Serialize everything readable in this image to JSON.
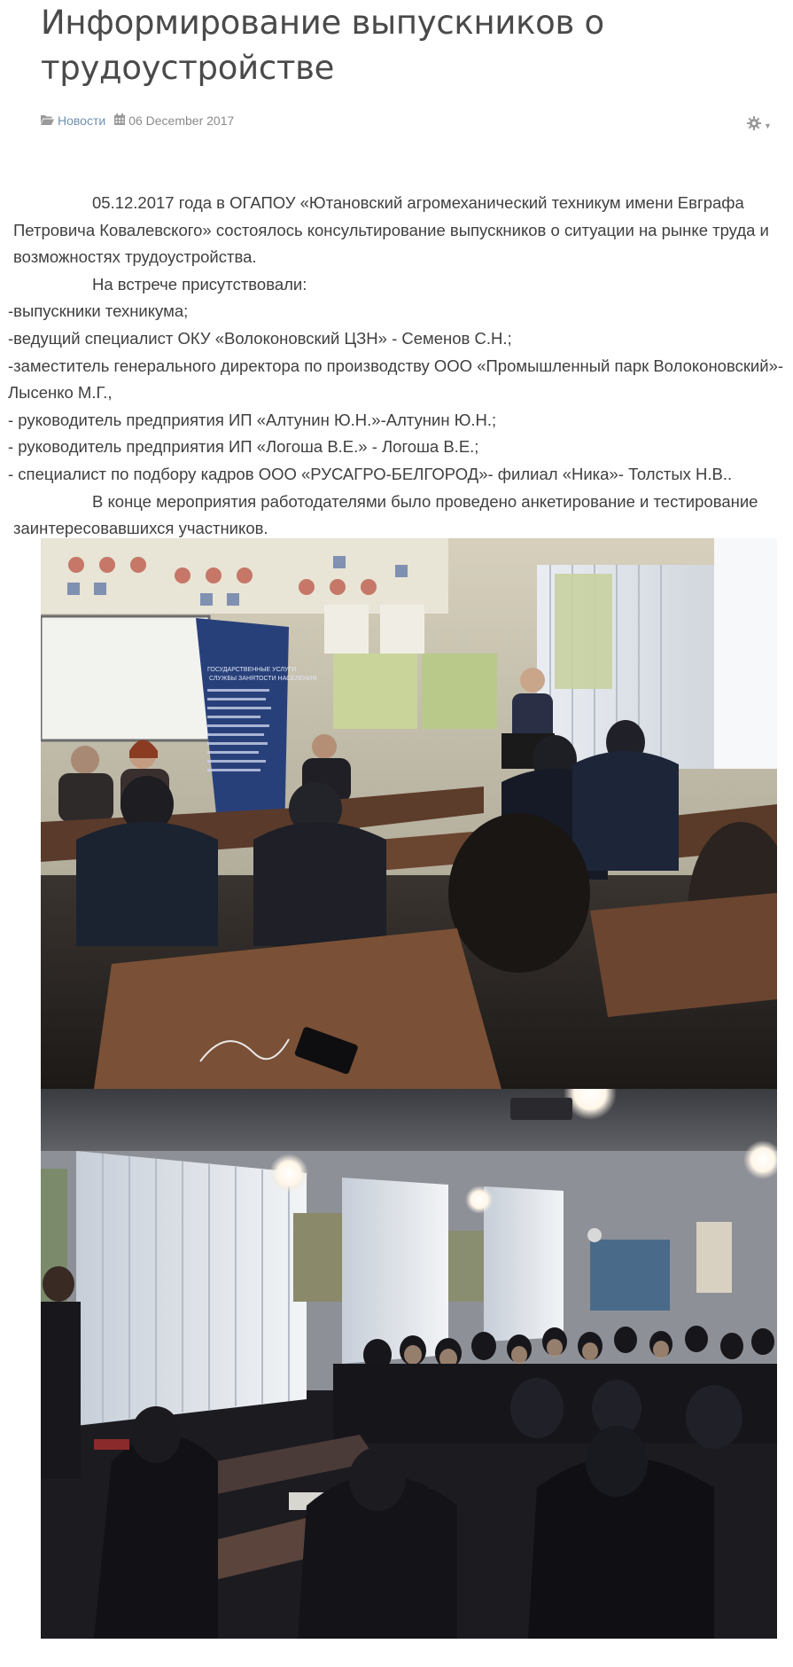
{
  "article": {
    "title_line1": "Информирование выпускников о",
    "title_line2": "трудоустройстве",
    "category": "Новости",
    "date": "06 December 2017",
    "category_icon": "folder-open-icon",
    "date_icon": "calendar-icon",
    "tools_icon": "gear-icon"
  },
  "body": {
    "l1": "05.12.2017 года в ОГАПОУ «Ютановский агромеханический техникум имени Евграфа",
    "l2": "Петровича Ковалевского» состоялось консультирование выпускников о ситуации на рынке труда и",
    "l3": "возможностях трудоустройства.",
    "l4": "На встрече присутствовали:",
    "l5": "-выпускники техникума;",
    "l6": "-ведущий специалист ОКУ «Волоконовский ЦЗН» - Семенов С.Н.;",
    "l7": "-заместитель генерального директора по производству ООО «Промышленный парк Волоконовский»-",
    "l8": "Лысенко М.Г.,",
    "l9": "- руководитель предприятия ИП «Алтунин Ю.Н.»-Алтунин Ю.Н.;",
    "l10": "- руководитель предприятия ИП «Логоша В.Е.» - Логоша В.Е.;",
    "l11": "- специалист по подбору кадров ООО «РУСАГРО-БЕЛГОРОД»- филиал «Ника»- Толстых Н.В..",
    "l12": "В конце мероприятия работодателями было проведено анкетирование и тестирование",
    "l13": "заинтересовавшихся участников."
  },
  "photos": {
    "banner_line1": "ГОСУДАРСТВЕННЫЕ УСЛУГИ",
    "banner_line2": "СЛУЖБЫ ЗАНЯТОСТИ НАСЕЛЕНИЯ"
  }
}
